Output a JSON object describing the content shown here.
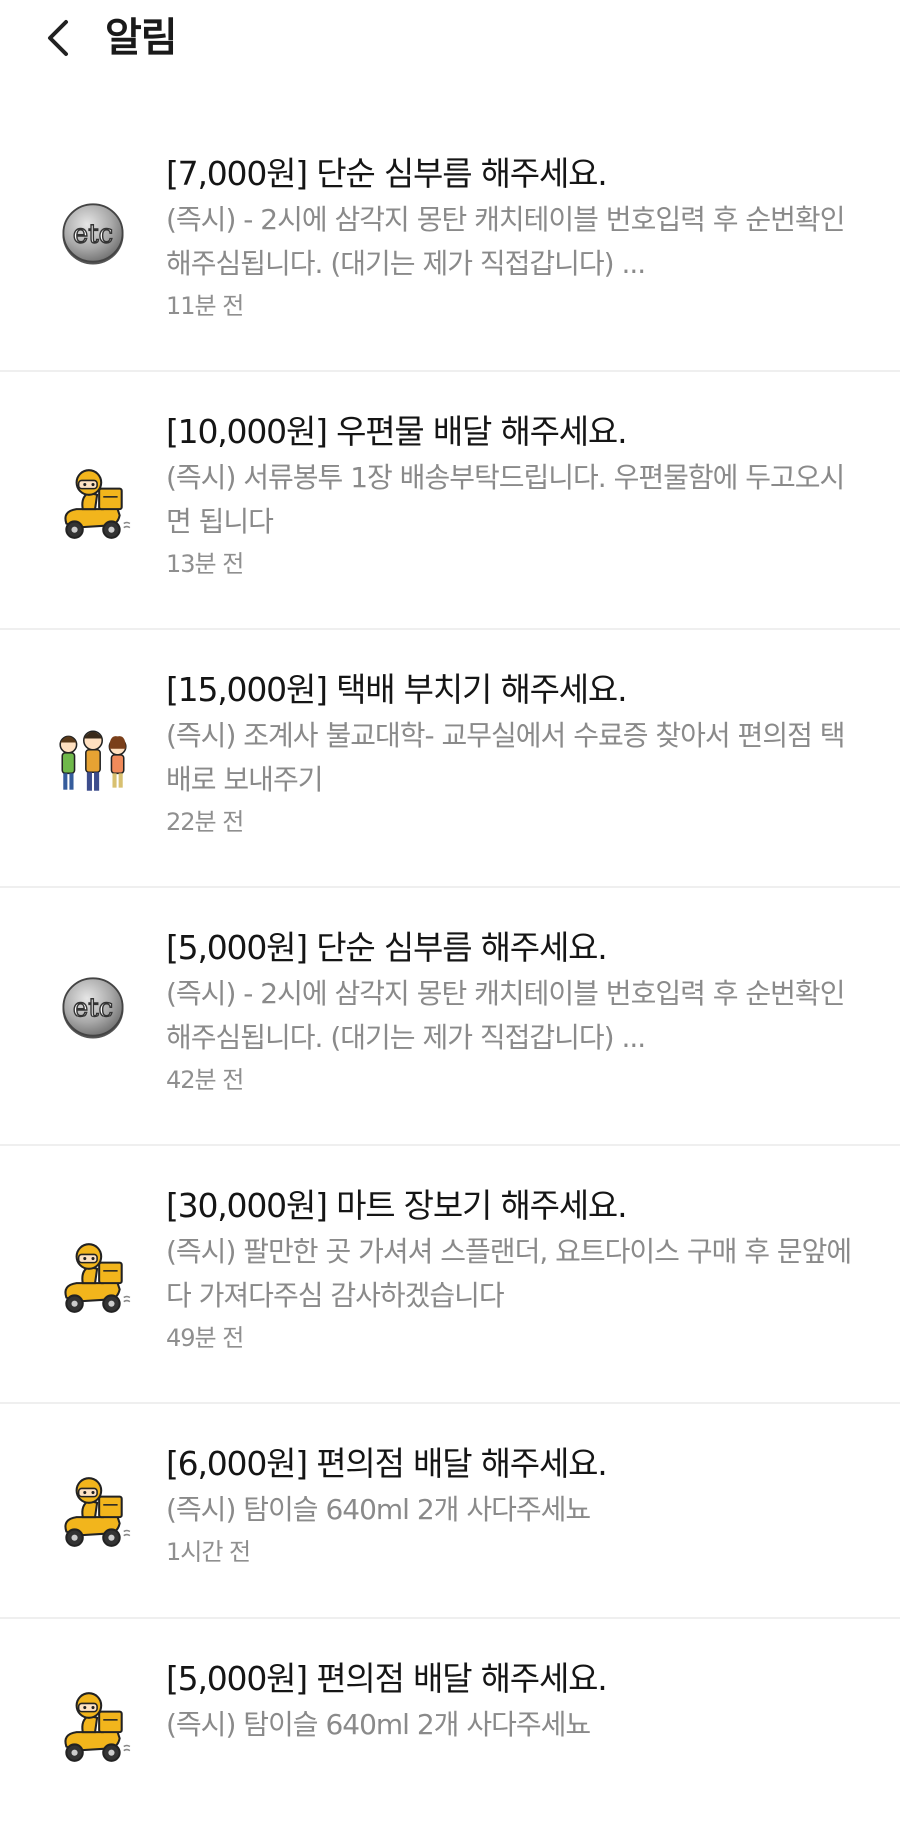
{
  "header": {
    "title": "알림"
  },
  "notifications": [
    {
      "title": "[7,000원] 단순 심부름 해주세요.",
      "body": "(즉시) - 2시에 삼각지 몽탄 캐치테이블 번호입력 후 순번확인 해주심됩니다. (대기는 제가 직접갑니다) ...",
      "time": "11분 전",
      "icon": "etc-icon"
    },
    {
      "title": "[10,000원] 우편물 배달 해주세요.",
      "body": "(즉시) 서류봉투 1장 배송부탁드립니다. 우편물함에 두고오시면 됩니다",
      "time": "13분 전",
      "icon": "delivery-scooter-icon"
    },
    {
      "title": "[15,000원] 택배 부치기 해주세요.",
      "body": "(즉시) 조계사 불교대학- 교무실에서 수료증 찾아서 편의점 택배로 보내주기",
      "time": "22분 전",
      "icon": "people-group-icon"
    },
    {
      "title": "[5,000원] 단순 심부름 해주세요.",
      "body": "(즉시) - 2시에 삼각지 몽탄 캐치테이블 번호입력 후 순번확인 해주심됩니다. (대기는 제가 직접갑니다) ...",
      "time": "42분 전",
      "icon": "etc-icon"
    },
    {
      "title": "[30,000원] 마트 장보기 해주세요.",
      "body": "(즉시) 팔만한 곳 가셔셔 스플랜더, 요트다이스 구매 후 문앞에 다 가져다주심 감사하겠습니다",
      "time": "49분 전",
      "icon": "delivery-scooter-icon"
    },
    {
      "title": "[6,000원] 편의점 배달 해주세요.",
      "body": "(즉시) 탐이슬 640ml 2개 사다주세뇨",
      "time": "1시간 전",
      "icon": "delivery-scooter-icon"
    },
    {
      "title": "[5,000원] 편의점 배달 해주세요.",
      "body": "(즉시) 탐이슬 640ml 2개 사다주세뇨",
      "time": "",
      "icon": "delivery-scooter-icon"
    }
  ]
}
